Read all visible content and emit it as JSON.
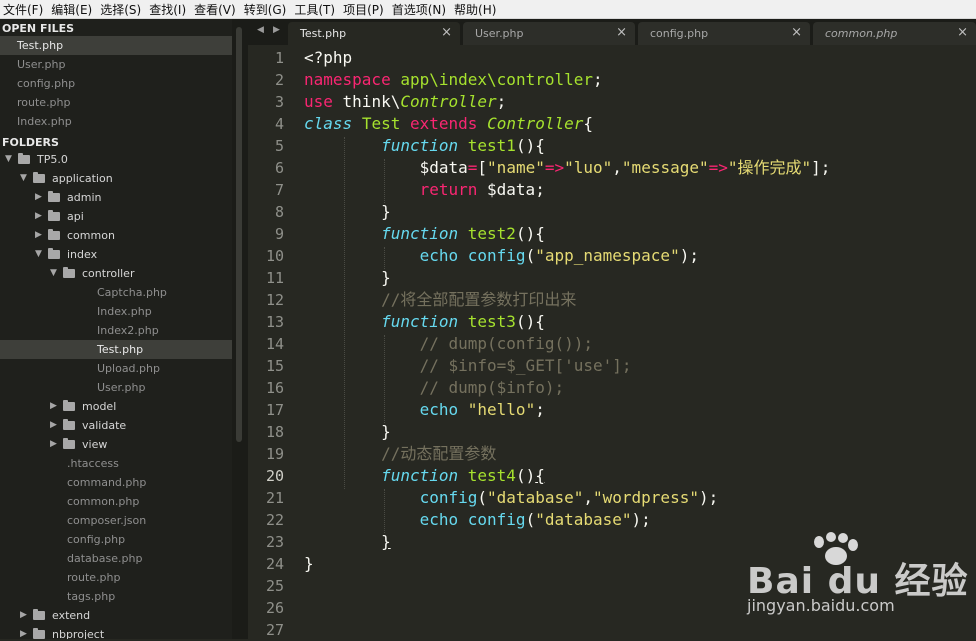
{
  "menu": [
    "文件(F)",
    "编辑(E)",
    "选择(S)",
    "查找(I)",
    "查看(V)",
    "转到(G)",
    "工具(T)",
    "项目(P)",
    "首选项(N)",
    "帮助(H)"
  ],
  "sidebar": {
    "open_files_header": "OPEN FILES",
    "open_files": [
      "Test.php",
      "User.php",
      "config.php",
      "route.php",
      "Index.php"
    ],
    "folders_header": "FOLDERS",
    "tree": {
      "root": "TP5.0",
      "application": "application",
      "admin": "admin",
      "api": "api",
      "common": "common",
      "index": "index",
      "controller": "controller",
      "controller_files": [
        "Captcha.php",
        "Index.php",
        "Index2.php",
        "Test.php",
        "Upload.php",
        "User.php"
      ],
      "model": "model",
      "validate": "validate",
      "view": "view",
      "app_files": [
        ".htaccess",
        "command.php",
        "common.php",
        "composer.json",
        "config.php",
        "database.php",
        "route.php",
        "tags.php"
      ],
      "extend": "extend",
      "nbproject": "nbproject"
    }
  },
  "tabs": [
    {
      "label": "Test.php",
      "close": "×"
    },
    {
      "label": "User.php",
      "close": "×"
    },
    {
      "label": "config.php",
      "close": "×"
    },
    {
      "label": "common.php",
      "close": "×"
    }
  ],
  "nav_arrows": {
    "left": "◀",
    "right": "▶"
  },
  "editor": {
    "line_numbers": [
      "1",
      "2",
      "3",
      "4",
      "5",
      "6",
      "7",
      "8",
      "9",
      "10",
      "11",
      "12",
      "13",
      "14",
      "15",
      "16",
      "17",
      "18",
      "19",
      "20",
      "21",
      "22",
      "23",
      "24",
      "25",
      "26",
      "27"
    ],
    "current_line": 20,
    "lines": [
      [
        [
          "t",
          "<?php"
        ]
      ],
      [
        [
          "kw",
          "namespace"
        ],
        [
          "t",
          " "
        ],
        [
          "fn",
          "app\\index\\controller"
        ],
        [
          "t",
          ";"
        ]
      ],
      [
        [
          "kw",
          "use"
        ],
        [
          "t",
          " think\\"
        ],
        [
          "it",
          "Controller"
        ],
        [
          "t",
          ";"
        ]
      ],
      [
        [
          "st",
          "class"
        ],
        [
          "t",
          " "
        ],
        [
          "fn",
          "Test"
        ],
        [
          "t",
          " "
        ],
        [
          "kw",
          "extends"
        ],
        [
          "t",
          " "
        ],
        [
          "it",
          "Controller"
        ],
        [
          "t",
          "{"
        ]
      ],
      [
        [
          "t",
          "        "
        ],
        [
          "st",
          "function"
        ],
        [
          "t",
          " "
        ],
        [
          "fn",
          "test1"
        ],
        [
          "t",
          "(){"
        ]
      ],
      [
        [
          "t",
          "            $data"
        ],
        [
          "kw",
          "="
        ],
        [
          "t",
          "["
        ],
        [
          "s",
          "\"name\""
        ],
        [
          "kw",
          "=>"
        ],
        [
          "s",
          "\"luo\""
        ],
        [
          "t",
          ","
        ],
        [
          "s",
          "\"message\""
        ],
        [
          "kw",
          "=>"
        ],
        [
          "s",
          "\"操作完成\""
        ],
        [
          "t",
          "];"
        ]
      ],
      [
        [
          "t",
          "            "
        ],
        [
          "kw",
          "return"
        ],
        [
          "t",
          " $data;"
        ]
      ],
      [
        [
          "t",
          "        }"
        ]
      ],
      [
        [
          "t",
          "        "
        ],
        [
          "st",
          "function"
        ],
        [
          "t",
          " "
        ],
        [
          "fn",
          "test2"
        ],
        [
          "t",
          "(){"
        ]
      ],
      [
        [
          "t",
          "            "
        ],
        [
          "b",
          "echo"
        ],
        [
          "t",
          " "
        ],
        [
          "b",
          "config"
        ],
        [
          "t",
          "("
        ],
        [
          "s",
          "\"app_namespace\""
        ],
        [
          "t",
          ");"
        ]
      ],
      [
        [
          "t",
          "        }"
        ]
      ],
      [
        [
          "t",
          "        "
        ],
        [
          "c",
          "//将全部配置参数打印出来"
        ]
      ],
      [
        [
          "t",
          "        "
        ],
        [
          "st",
          "function"
        ],
        [
          "t",
          " "
        ],
        [
          "fn",
          "test3"
        ],
        [
          "t",
          "(){"
        ]
      ],
      [
        [
          "t",
          "            "
        ],
        [
          "c",
          "// dump(config());"
        ]
      ],
      [
        [
          "t",
          "            "
        ],
        [
          "c",
          "// $info=$_GET['use'];"
        ]
      ],
      [
        [
          "t",
          "            "
        ],
        [
          "c",
          "// dump($info);"
        ]
      ],
      [
        [
          "t",
          "            "
        ],
        [
          "b",
          "echo"
        ],
        [
          "t",
          " "
        ],
        [
          "s",
          "\"hello\""
        ],
        [
          "t",
          ";"
        ]
      ],
      [
        [
          "t",
          "        }"
        ]
      ],
      [
        [
          "t",
          "        "
        ],
        [
          "c",
          "//动态配置参数"
        ]
      ],
      [
        [
          "t",
          "        "
        ],
        [
          "st",
          "function"
        ],
        [
          "t",
          " "
        ],
        [
          "fn",
          "test4"
        ],
        [
          "t",
          "()"
        ],
        [
          "u",
          "{"
        ]
      ],
      [
        [
          "t",
          "            "
        ],
        [
          "b",
          "config"
        ],
        [
          "t",
          "("
        ],
        [
          "s",
          "\"database\""
        ],
        [
          "t",
          ","
        ],
        [
          "s",
          "\"wordpress\""
        ],
        [
          "t",
          ");"
        ]
      ],
      [
        [
          "t",
          "            "
        ],
        [
          "b",
          "echo"
        ],
        [
          "t",
          " "
        ],
        [
          "b",
          "config"
        ],
        [
          "t",
          "("
        ],
        [
          "s",
          "\"database\""
        ],
        [
          "t",
          ");"
        ]
      ],
      [
        [
          "t",
          "        "
        ],
        [
          "u",
          "}"
        ]
      ],
      [
        [
          "t",
          "}"
        ]
      ],
      [],
      [],
      []
    ]
  },
  "watermark": {
    "brand": "Bai du 经验",
    "url": "jingyan.baidu.com"
  },
  "colors": {
    "bg": "#272822",
    "keyword": "#f92672",
    "function": "#a6e22e",
    "string": "#e6db74",
    "comment": "#75715e",
    "builtin": "#66d9ef"
  }
}
